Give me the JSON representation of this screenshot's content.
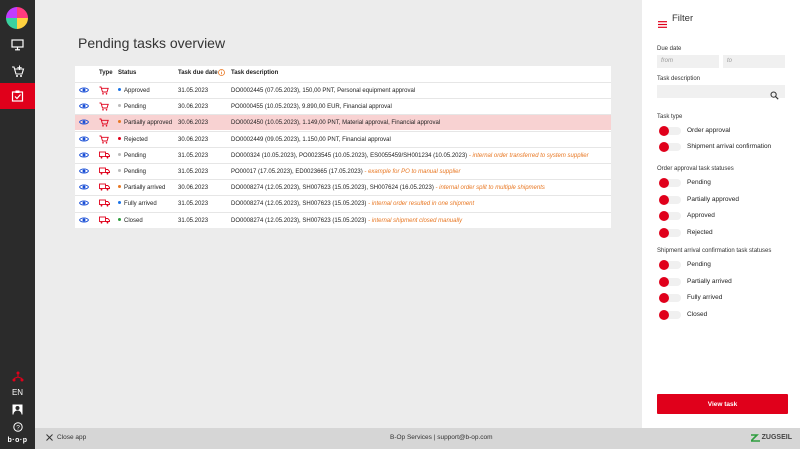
{
  "nav": {
    "language": "EN",
    "brand": "b·o·p"
  },
  "page": {
    "title": "Pending tasks overview"
  },
  "table": {
    "headers": {
      "type": "Type",
      "status": "Status",
      "due_date": "Task due date",
      "description": "Task description"
    },
    "rows": [
      {
        "icon": "cart",
        "status": "Approved",
        "status_color": "#1a73e8",
        "date": "31.05.2023",
        "desc": "DO0002445 (07.05.2023), 150,00 PNT, Personal equipment approval",
        "note": "",
        "highlight": false
      },
      {
        "icon": "cart",
        "status": "Pending",
        "status_color": "#bbbbbb",
        "date": "30.06.2023",
        "desc": "PO0000455 (10.05.2023), 9.890,00 EUR, Financial approval",
        "note": "",
        "highlight": false
      },
      {
        "icon": "cart",
        "status": "Partially approved",
        "status_color": "#e87722",
        "date": "30.06.2023",
        "desc": "DO0002450 (10.05.2023), 1.149,00 PNT, Material approval, Financial approval",
        "note": "",
        "highlight": true
      },
      {
        "icon": "cart",
        "status": "Rejected",
        "status_color": "#e0001b",
        "date": "30.06.2023",
        "desc": "DO0002449 (09.05.2023), 1.150,00 PNT, Financial approval",
        "note": "",
        "highlight": false
      },
      {
        "icon": "truck",
        "status": "Pending",
        "status_color": "#bbbbbb",
        "date": "31.05.2023",
        "desc": "DO000324 (10.05.2023), PO0023545 (10.05.2023), ES0055459/SH001234 (10.05.2023)",
        "note": "- internal order transferred to system supplier",
        "highlight": false
      },
      {
        "icon": "truck",
        "status": "Pending",
        "status_color": "#bbbbbb",
        "date": "31.05.2023",
        "desc": "PO00017 (17.05.2023), ED0023665 (17.05.2023)",
        "note": "- example for PO to manual supplier",
        "highlight": false
      },
      {
        "icon": "truck",
        "status": "Partially arrived",
        "status_color": "#e87722",
        "date": "30.06.2023",
        "desc": "DO0008274 (12.05.2023), SH007623 (15.05.2023), SH007624 (16.05.2023)",
        "note": "- internal order split to multiple shipments",
        "highlight": false
      },
      {
        "icon": "truck",
        "status": "Fully arrived",
        "status_color": "#1a73e8",
        "date": "31.05.2023",
        "desc": "DO0008274 (12.05.2023), SH007623 (15.05.2023)",
        "note": "- internal order resulted in one shipment",
        "highlight": false
      },
      {
        "icon": "truck",
        "status": "Closed",
        "status_color": "#2e9e3e",
        "date": "31.05.2023",
        "desc": "DO0008274 (12.05.2023), SH007623 (15.05.2023)",
        "note": "- internal shipment closed manually",
        "highlight": false
      }
    ]
  },
  "filter": {
    "title": "Filter",
    "due_date_label": "Due date",
    "from_placeholder": "from",
    "to_placeholder": "to",
    "task_description_label": "Task description",
    "task_type_label": "Task type",
    "task_types": [
      "Order approval",
      "Shipment arrival confirmation"
    ],
    "order_status_label": "Order approval task statuses",
    "order_statuses": [
      "Pending",
      "Partially approved",
      "Approved",
      "Rejected"
    ],
    "shipment_status_label": "Shipment arrival confirmation task statuses",
    "shipment_statuses": [
      "Pending",
      "Partially arrived",
      "Fully arrived",
      "Closed"
    ],
    "view_button": "View task"
  },
  "footer": {
    "close_label": "Close app",
    "center_text": "B-Op Services | support@b-op.com",
    "logo_text": "ZUGSEIL"
  },
  "colors": {
    "accent": "#e0001b",
    "eye_icon": "#1a4fd6"
  }
}
